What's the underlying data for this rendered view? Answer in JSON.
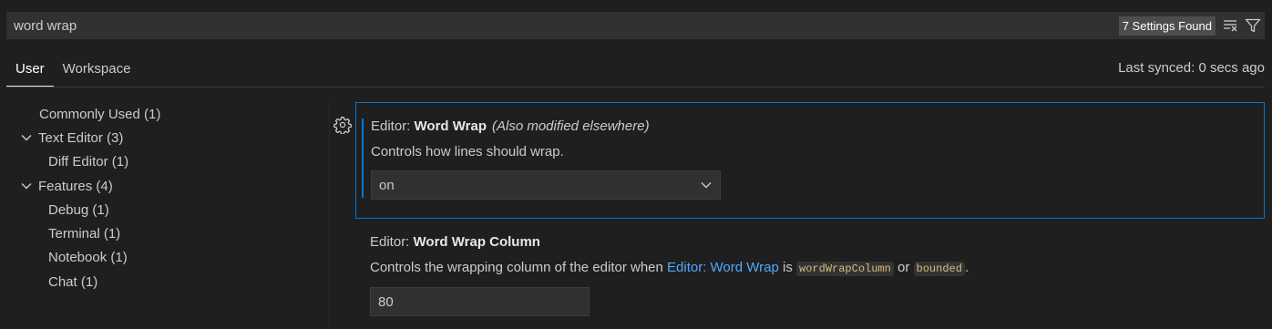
{
  "search": {
    "value": "word wrap",
    "results_badge": "7 Settings Found"
  },
  "tabs": [
    {
      "label": "User"
    },
    {
      "label": "Workspace"
    }
  ],
  "sync_status": "Last synced: 0 secs ago",
  "toc": [
    {
      "label": "Commonly Used (1)"
    },
    {
      "label": "Text Editor (3)"
    },
    {
      "label": "Diff Editor (1)"
    },
    {
      "label": "Features (4)"
    },
    {
      "label": "Debug (1)"
    },
    {
      "label": "Terminal (1)"
    },
    {
      "label": "Notebook (1)"
    },
    {
      "label": "Chat (1)"
    }
  ],
  "settings": [
    {
      "category": "Editor: ",
      "name": "Word Wrap",
      "note": "(Also modified elsewhere)",
      "description": "Controls how lines should wrap.",
      "value": "on"
    },
    {
      "category": "Editor: ",
      "name": "Word Wrap Column",
      "description_pre": "Controls the wrapping column of the editor when ",
      "description_link": "Editor: Word Wrap",
      "description_mid": " is ",
      "code1": "wordWrapColumn",
      "description_or": " or ",
      "code2": "bounded",
      "description_end": ".",
      "value": "80"
    }
  ],
  "colors": {
    "accent": "#0078d4",
    "link": "#4daafc",
    "background": "#1f1f1f"
  }
}
